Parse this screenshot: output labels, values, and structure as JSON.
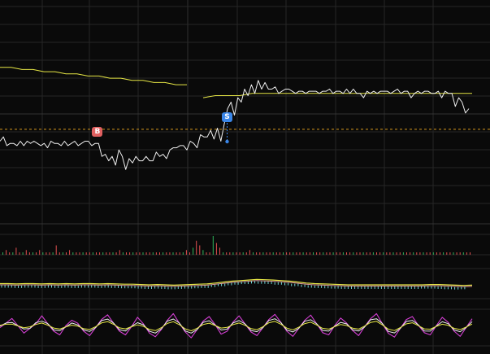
{
  "chart_data": {
    "type": "line",
    "title": "",
    "colors": {
      "background": "#0a0a0a",
      "grid": "#262626",
      "price": "#f0f0f0",
      "average": "#e6e645",
      "reference_line": "#d79a1e",
      "volume_up": "#2fb35a",
      "volume_down": "#e05050",
      "indicator_a": "#e6e645",
      "indicator_b": "#6fd6d6",
      "oscillator_fast": "#d43fd4",
      "oscillator_mid": "#f0f0f0",
      "oscillator_slow": "#e6e645",
      "buy_marker": "#e06060",
      "sell_marker": "#3a86e8"
    },
    "markers": [
      {
        "label": "B",
        "type": "buy"
      },
      {
        "label": "S",
        "type": "sell"
      }
    ],
    "price_series": [
      0.38,
      0.4,
      0.36,
      0.37,
      0.37,
      0.36,
      0.38,
      0.36,
      0.38,
      0.37,
      0.38,
      0.37,
      0.36,
      0.37,
      0.35,
      0.38,
      0.37,
      0.37,
      0.36,
      0.38,
      0.36,
      0.37,
      0.38,
      0.36,
      0.37,
      0.38,
      0.38,
      0.36,
      0.37,
      0.37,
      0.31,
      0.32,
      0.29,
      0.31,
      0.27,
      0.34,
      0.31,
      0.25,
      0.3,
      0.28,
      0.31,
      0.29,
      0.29,
      0.31,
      0.29,
      0.29,
      0.33,
      0.31,
      0.32,
      0.3,
      0.34,
      0.35,
      0.35,
      0.36,
      0.36,
      0.34,
      0.38,
      0.37,
      0.35,
      0.41,
      0.4,
      0.4,
      0.43,
      0.39,
      0.44,
      0.38,
      0.46,
      0.53,
      0.56,
      0.5,
      0.58,
      0.56,
      0.62,
      0.59,
      0.64,
      0.6,
      0.66,
      0.62,
      0.65,
      0.62,
      0.62,
      0.63,
      0.6,
      0.61,
      0.62,
      0.62,
      0.61,
      0.6,
      0.61,
      0.61,
      0.6,
      0.61,
      0.61,
      0.61,
      0.6,
      0.61,
      0.61,
      0.62,
      0.6,
      0.61,
      0.61,
      0.6,
      0.62,
      0.6,
      0.62,
      0.6,
      0.6,
      0.58,
      0.61,
      0.6,
      0.61,
      0.6,
      0.61,
      0.61,
      0.61,
      0.6,
      0.61,
      0.62,
      0.6,
      0.61,
      0.61,
      0.58,
      0.6,
      0.61,
      0.6,
      0.61,
      0.61,
      0.6,
      0.6,
      0.61,
      0.58,
      0.61,
      0.6,
      0.6,
      0.54,
      0.58,
      0.56,
      0.51,
      0.53
    ],
    "average_series": [
      0.72,
      0.72,
      0.71,
      0.71,
      0.7,
      0.7,
      0.69,
      0.69,
      0.68,
      0.68,
      0.67,
      0.67,
      0.66,
      0.66,
      0.65,
      0.65,
      0.64,
      0.64,
      0.58,
      0.59,
      0.59,
      0.59,
      0.6,
      0.6,
      0.6,
      0.6,
      0.6,
      0.6,
      0.6,
      0.6,
      0.6,
      0.6,
      0.6,
      0.6,
      0.6,
      0.6,
      0.6,
      0.6,
      0.6,
      0.6,
      0.6
    ],
    "reference_level": 0.435,
    "volume_series": [
      1,
      2,
      1,
      1,
      3,
      1,
      1,
      2,
      1,
      1,
      1,
      2,
      1,
      1,
      1,
      1,
      4,
      1,
      1,
      1,
      2,
      1,
      1,
      1,
      1,
      1,
      1,
      1,
      1,
      1,
      1,
      1,
      1,
      1,
      1,
      2,
      1,
      1,
      1,
      1,
      1,
      1,
      1,
      1,
      1,
      1,
      1,
      1,
      1,
      1,
      1,
      1,
      1,
      1,
      1,
      2,
      1,
      3,
      6,
      4,
      2,
      1,
      1,
      8,
      5,
      3,
      1,
      1,
      1,
      1,
      1,
      1,
      1,
      1,
      2,
      1,
      1,
      1,
      1,
      1,
      1,
      1,
      1,
      1,
      1,
      1,
      1,
      1,
      1,
      1,
      1,
      1,
      1,
      1,
      1,
      1,
      1,
      1,
      1,
      1,
      1,
      1,
      1,
      1,
      1,
      1,
      1,
      1,
      1,
      1,
      1,
      1,
      1,
      1,
      1,
      1,
      1,
      1,
      1,
      1,
      1,
      1,
      1,
      1,
      1,
      1,
      1,
      1,
      1,
      1,
      1,
      1,
      1,
      1,
      1,
      1,
      1,
      1,
      1,
      1,
      1
    ],
    "indicator_series": [
      0.5,
      0.5,
      0.49,
      0.5,
      0.5,
      0.49,
      0.5,
      0.49,
      0.5,
      0.49,
      0.5,
      0.5,
      0.49,
      0.5,
      0.49,
      0.48,
      0.48,
      0.47,
      0.46,
      0.47,
      0.46,
      0.45,
      0.46,
      0.47,
      0.48,
      0.49,
      0.52,
      0.55,
      0.58,
      0.6,
      0.62,
      0.64,
      0.63,
      0.62,
      0.6,
      0.58,
      0.55,
      0.52,
      0.5,
      0.49,
      0.48,
      0.47,
      0.46,
      0.46,
      0.46,
      0.46,
      0.46,
      0.46,
      0.46,
      0.46,
      0.46,
      0.46,
      0.47,
      0.47,
      0.46,
      0.45,
      0.44,
      0.45
    ],
    "oscillator_series": [
      0.5,
      0.62,
      0.75,
      0.55,
      0.35,
      0.48,
      0.6,
      0.82,
      0.6,
      0.4,
      0.3,
      0.55,
      0.7,
      0.62,
      0.4,
      0.28,
      0.5,
      0.72,
      0.85,
      0.62,
      0.4,
      0.3,
      0.52,
      0.78,
      0.6,
      0.35,
      0.25,
      0.45,
      0.7,
      0.88,
      0.62,
      0.38,
      0.22,
      0.45,
      0.68,
      0.8,
      0.58,
      0.32,
      0.4,
      0.65,
      0.82,
      0.6,
      0.38,
      0.28,
      0.5,
      0.72,
      0.86,
      0.64,
      0.4,
      0.26,
      0.48,
      0.7,
      0.84,
      0.6,
      0.36,
      0.3,
      0.55,
      0.76,
      0.62,
      0.42,
      0.28,
      0.52,
      0.74,
      0.88,
      0.6,
      0.34,
      0.24,
      0.48,
      0.72,
      0.8,
      0.56,
      0.36,
      0.3,
      0.55,
      0.78,
      0.64,
      0.4,
      0.26,
      0.5,
      0.74
    ]
  }
}
